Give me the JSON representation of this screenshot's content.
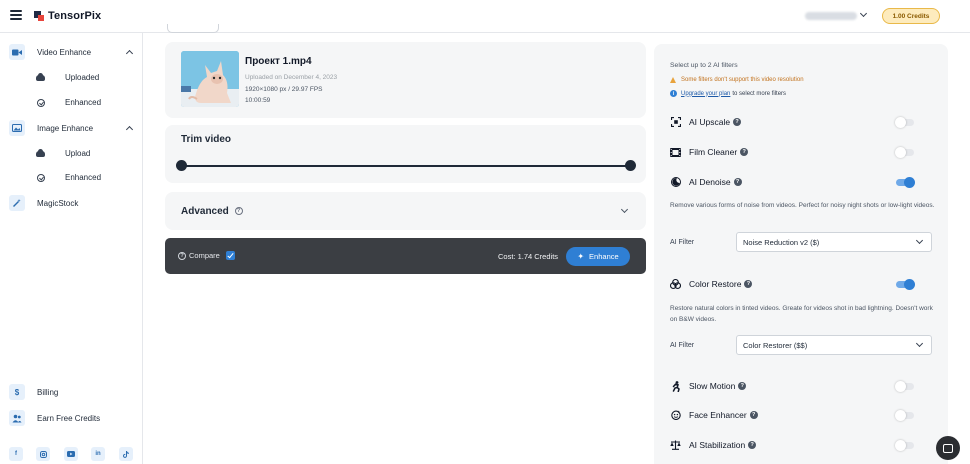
{
  "header": {
    "app_name": "TensorPix",
    "credits_label": "1.00 Credits"
  },
  "sidebar": {
    "video_enhance": {
      "label": "Video Enhance",
      "items": [
        {
          "label": "Uploaded",
          "icon": "cloud-upload-icon"
        },
        {
          "label": "Enhanced",
          "icon": "check-circle-icon"
        }
      ]
    },
    "image_enhance": {
      "label": "Image Enhance",
      "items": [
        {
          "label": "Upload",
          "icon": "cloud-upload-icon"
        },
        {
          "label": "Enhanced",
          "icon": "check-circle-icon"
        }
      ]
    },
    "magicstock": {
      "label": "MagicStock"
    },
    "billing": {
      "label": "Billing",
      "icon_glyph": "$"
    },
    "earn": {
      "label": "Earn Free Credits"
    },
    "socials": [
      "facebook-icon",
      "instagram-icon",
      "youtube-icon",
      "linkedin-icon",
      "tiktok-icon"
    ]
  },
  "video": {
    "title": "Проект 1.mp4",
    "uploaded": "Uploaded on December 4, 2023",
    "resolution": "1920×1080 px / 29.97 FPS",
    "duration": "10:00:59"
  },
  "trim": {
    "title": "Trim video",
    "range_start": 0,
    "range_end": 1
  },
  "advanced": {
    "title": "Advanced"
  },
  "action_bar": {
    "compare_label": "Compare",
    "compare_checked": true,
    "cost": "Cost: 1.74 Credits",
    "enhance_label": "Enhance"
  },
  "filters_panel": {
    "heading": "Select up to 2 AI filters",
    "warning": "Some filters don't support this video resolution",
    "upgrade_link": "Upgrade your plan",
    "upgrade_suffix": "to select more filters",
    "filters": [
      {
        "label": "AI Upscale",
        "on": false,
        "icon": "upscale-icon"
      },
      {
        "label": "Film Cleaner",
        "on": false,
        "icon": "film-icon"
      },
      {
        "label": "AI Denoise",
        "on": true,
        "icon": "moon-icon"
      },
      {
        "label": "Color Restore",
        "on": true,
        "icon": "palette-icon"
      },
      {
        "label": "Slow Motion",
        "on": false,
        "icon": "running-icon"
      },
      {
        "label": "Face Enhancer",
        "on": false,
        "icon": "face-icon"
      },
      {
        "label": "AI Stabilization",
        "on": false,
        "icon": "balance-icon"
      }
    ],
    "denoise_desc": "Remove various forms of noise from videos. Perfect for noisy night shots or low-light videos.",
    "color_desc": "Restore natural colors in tinted videos. Greate for videos shot in bad lightning. Doesn't work on B&W videos.",
    "ai_filter_label": "AI Filter",
    "denoise_select": "Noise Reduction v2 ($)",
    "color_select": "Color Restorer ($$)"
  },
  "colors": {
    "accent": "#2f7fd4",
    "credits_bg": "#fdebbd",
    "action_bar": "#3b3e43"
  }
}
